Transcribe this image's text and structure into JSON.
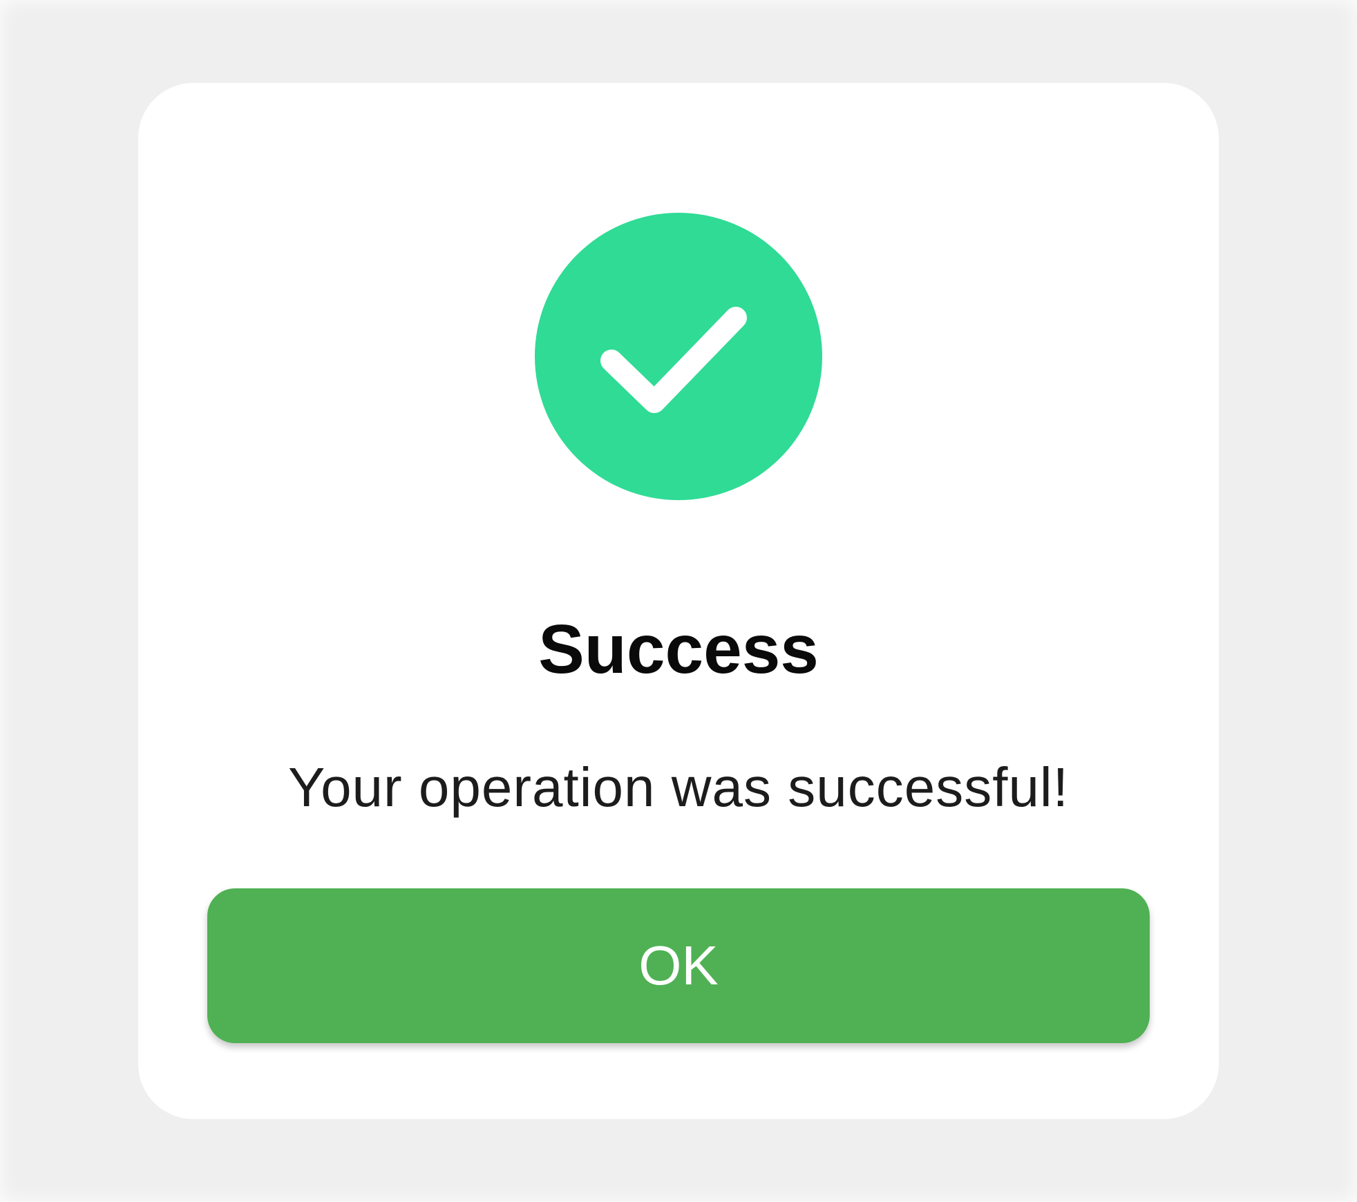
{
  "dialog": {
    "icon": "check-circle-icon",
    "title": "Success",
    "message": "Your operation was successful!",
    "button_label": "OK"
  },
  "colors": {
    "background": "#efefef",
    "dialog": "#ffffff",
    "icon_circle": "#2fdb95",
    "button": "#4fb153",
    "button_text": "#ffffff"
  }
}
